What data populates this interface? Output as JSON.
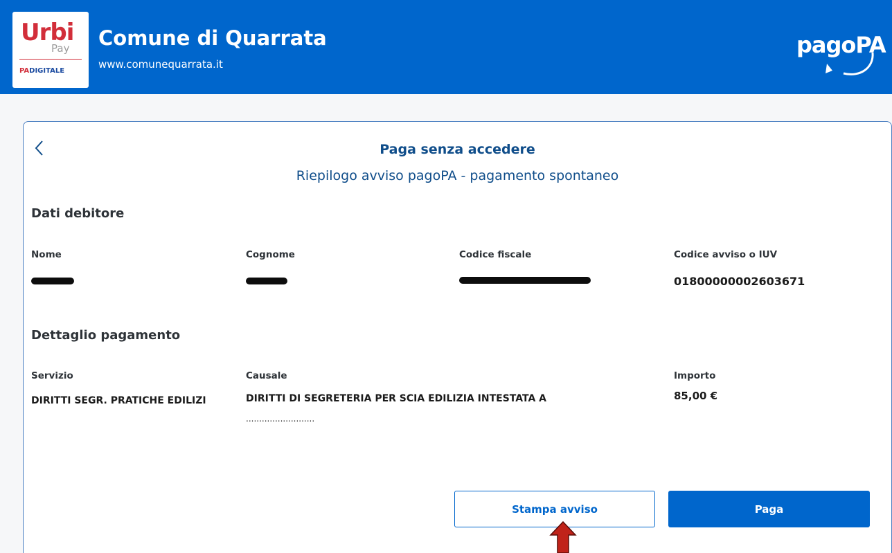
{
  "header": {
    "logo_primary": "Urbi",
    "logo_secondary": "Pay",
    "logo_tag_a": "PA",
    "logo_tag_b": "DIGITALE",
    "title": "Comune di Quarrata",
    "url": "www.comunequarrata.it",
    "brand": "pagoPA",
    "color_bar": "#0066cc"
  },
  "page": {
    "title": "Paga senza accedere",
    "subtitle": "Riepilogo avviso pagoPA - pagamento spontaneo"
  },
  "debtor": {
    "heading": "Dati debitore",
    "name_label": "Nome",
    "surname_label": "Cognome",
    "fiscal_label": "Codice fiscale",
    "iuv_label": "Codice avviso o IUV",
    "iuv_value": "01800000002603671"
  },
  "payment": {
    "heading": "Dettaglio pagamento",
    "service_label": "Servizio",
    "service_value": "DIRITTI SEGR. PRATICHE EDILIZI",
    "reason_label": "Causale",
    "reason_line1": "DIRITTI DI SEGRETERIA PER SCIA EDILIZIA INTESTATA A",
    "reason_line2": "..........................",
    "amount_label": "Importo",
    "amount_value": "85,00 €"
  },
  "actions": {
    "print_label": "Stampa avviso",
    "pay_label": "Paga"
  },
  "icons": {
    "back": "chevron-left-icon",
    "annotation": "red-arrow-up"
  }
}
